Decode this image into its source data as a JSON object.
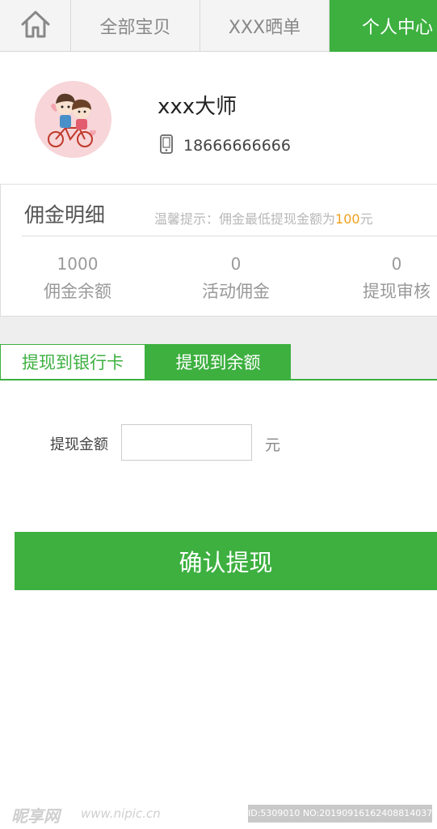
{
  "nav": {
    "home_icon": "home-icon",
    "tabs": [
      {
        "label": "全部宝贝"
      },
      {
        "label": "XXX晒单"
      },
      {
        "label": "个人中心"
      }
    ],
    "active_color": "#3db040"
  },
  "profile": {
    "name": "xxx大师",
    "phone_icon": "phone-icon",
    "phone": "18666666666"
  },
  "commission": {
    "title": "佣金明细",
    "tip_prefix": "温馨提示：佣金最低提现金额为",
    "tip_amount": "100",
    "tip_suffix": "元",
    "tip_amount_color": "#f1a01c",
    "stats": [
      {
        "value": "1000",
        "label": "佣金余额"
      },
      {
        "value": "0",
        "label": "活动佣金"
      },
      {
        "value": "0",
        "label": "提现审核"
      }
    ]
  },
  "withdraw_tabs": [
    {
      "label": "提现到银行卡",
      "active": false
    },
    {
      "label": "提现到余额",
      "active": true
    }
  ],
  "form": {
    "amount_label": "提现金额",
    "amount_value": "",
    "unit": "元",
    "confirm_label": "确认提现"
  },
  "watermark": {
    "logo": "昵享网",
    "url": "www.nipic.cn",
    "id": "ID:5309010 NO:20190916162408814037"
  }
}
